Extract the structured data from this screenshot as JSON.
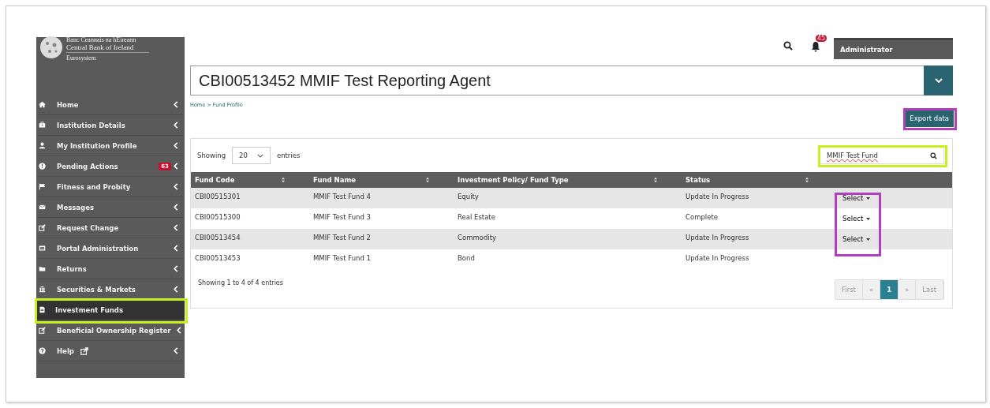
{
  "logo": {
    "irish_name": "Banc Ceannais na hÉireann",
    "name": "Central Bank of Ireland",
    "tagline": "Eurosystem"
  },
  "sidebar": {
    "items": [
      {
        "label": "Home",
        "selected": false
      },
      {
        "label": "Institution Details",
        "selected": false
      },
      {
        "label": "My Institution Profile",
        "selected": false
      },
      {
        "label": "Pending Actions",
        "selected": false,
        "badge": "63"
      },
      {
        "label": "Fitness and Probity",
        "selected": false
      },
      {
        "label": "Messages",
        "selected": false
      },
      {
        "label": "Request Change",
        "selected": false
      },
      {
        "label": "Portal Administration",
        "selected": false
      },
      {
        "label": "Returns",
        "selected": false
      },
      {
        "label": "Securities & Markets",
        "selected": false
      },
      {
        "label": "Investment Funds",
        "selected": true,
        "annotated": true
      },
      {
        "label": "Beneficial Ownership Register",
        "selected": false
      },
      {
        "label": "Help",
        "selected": false,
        "external": true
      }
    ]
  },
  "topbar": {
    "notifications": "45",
    "user": "Administrator"
  },
  "institution": {
    "value": "CBI00513452 MMIF Test Reporting Agent"
  },
  "breadcrumb": "Home > Fund Profile",
  "export_button": {
    "label": "Export data",
    "annotated": true
  },
  "table_controls": {
    "showing": "Showing",
    "page_size": "20",
    "entries": "entries",
    "search_value": "MMIF Test Fund",
    "search_annotated": true
  },
  "table": {
    "actions_annotated": true,
    "columns": [
      {
        "label": "Fund Code",
        "sortable": true
      },
      {
        "label": "Fund Name",
        "sortable": true
      },
      {
        "label": "Investment Policy/ Fund Type",
        "sortable": true
      },
      {
        "label": "Status",
        "sortable": true
      }
    ],
    "rows": [
      {
        "cells": [
          "CBI00515301",
          "MMIF Test Fund 4",
          "Equity",
          "Update In Progress"
        ],
        "action": "Select"
      },
      {
        "cells": [
          "CBI00515300",
          "MMIF Test Fund 3",
          "Real Estate",
          "Complete"
        ],
        "action": "Select"
      },
      {
        "cells": [
          "CBI00513454",
          "MMIF Test Fund 2",
          "Commodity",
          "Update In Progress"
        ],
        "action": "Select"
      },
      {
        "cells": [
          "CBI00513453",
          "MMIF Test Fund 1",
          "Bond",
          "Update In Progress"
        ]
      }
    ]
  },
  "table_info": "Showing 1 to 4 of 4 entries",
  "pagination": [
    {
      "label": "First",
      "selected": false,
      "disabled": true
    },
    {
      "label": "«",
      "selected": false,
      "disabled": true
    },
    {
      "label": "1",
      "selected": true,
      "disabled": false
    },
    {
      "label": "»",
      "selected": false,
      "disabled": true
    },
    {
      "label": "Last",
      "selected": false,
      "disabled": true
    }
  ]
}
